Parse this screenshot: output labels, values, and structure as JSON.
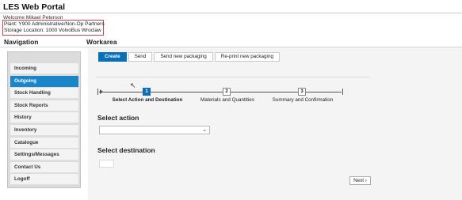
{
  "app": {
    "title": "LES Web Portal",
    "welcome": "Welcome Mikael Peterson",
    "plant": "Plant: Y900 Administrative/Non-Op Partners",
    "storage_location": "Storage Location: 1000 VolvoBus Wroclaw",
    "highlight_color": "#d2424a"
  },
  "navigation": {
    "heading": "Navigation",
    "items": [
      {
        "label": "Incoming",
        "active": false
      },
      {
        "label": "Outgoing",
        "active": true
      },
      {
        "label": "Stock Handling",
        "active": false
      },
      {
        "label": "Stock Reports",
        "active": false
      },
      {
        "label": "History",
        "active": false
      },
      {
        "label": "Inventory",
        "active": false
      },
      {
        "label": "Catalogue",
        "active": false
      },
      {
        "label": "Settings/Messages",
        "active": false
      },
      {
        "label": "Contact Us",
        "active": false
      },
      {
        "label": "Logoff",
        "active": false
      }
    ],
    "active_color": "#1a86c8"
  },
  "workarea": {
    "heading": "Workarea",
    "tabs": [
      {
        "label": "Create",
        "active": true
      },
      {
        "label": "Send",
        "active": false
      },
      {
        "label": "Send new packaging",
        "active": false
      },
      {
        "label": "Re-print new packaging",
        "active": false
      }
    ],
    "wizard": {
      "steps": [
        {
          "number": "1",
          "label": "Select Action and Destination",
          "active": true
        },
        {
          "number": "2",
          "label": "Materials and Quantities",
          "active": false
        },
        {
          "number": "3",
          "label": "Summary and Confirmation",
          "active": false
        }
      ]
    },
    "select_action": {
      "label": "Select action",
      "value": "",
      "icon": "chevron-down-icon"
    },
    "select_destination": {
      "label": "Select destination",
      "value": ""
    },
    "next_button": "Next ›",
    "accent_color": "#0a6fb5"
  }
}
